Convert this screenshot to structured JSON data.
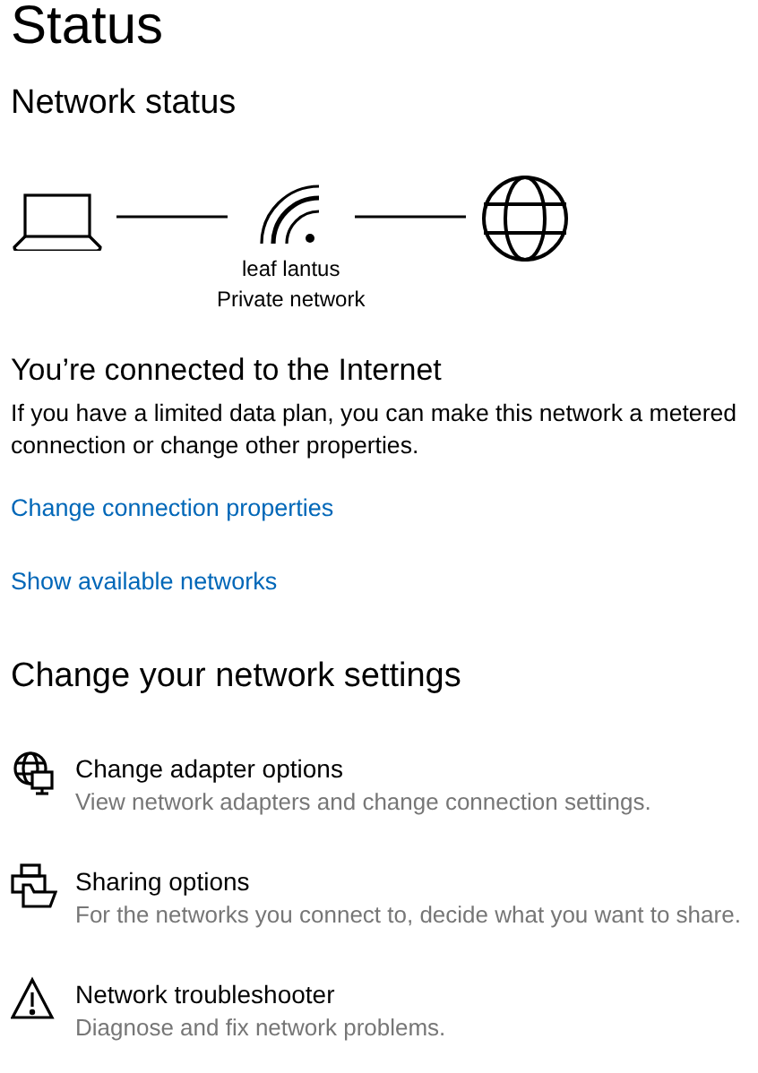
{
  "page_title": "Status",
  "network_status": {
    "heading": "Network status",
    "network_name": "leaf lantus",
    "network_type": "Private network"
  },
  "connection": {
    "heading": "You’re connected to the Internet",
    "description": "If you have a limited data plan, you can make this network a metered connection or change other properties."
  },
  "links": [
    "Change connection properties",
    "Show available networks"
  ],
  "settings": {
    "heading": "Change your network settings",
    "items": [
      {
        "kind": "adapter",
        "title": "Change adapter options",
        "description": "View network adapters and change connection settings."
      },
      {
        "kind": "sharing",
        "title": "Sharing options",
        "description": "For the networks you connect to, decide what you want to share."
      },
      {
        "kind": "troubleshooter",
        "title": "Network troubleshooter",
        "description": "Diagnose and fix network problems."
      }
    ]
  }
}
